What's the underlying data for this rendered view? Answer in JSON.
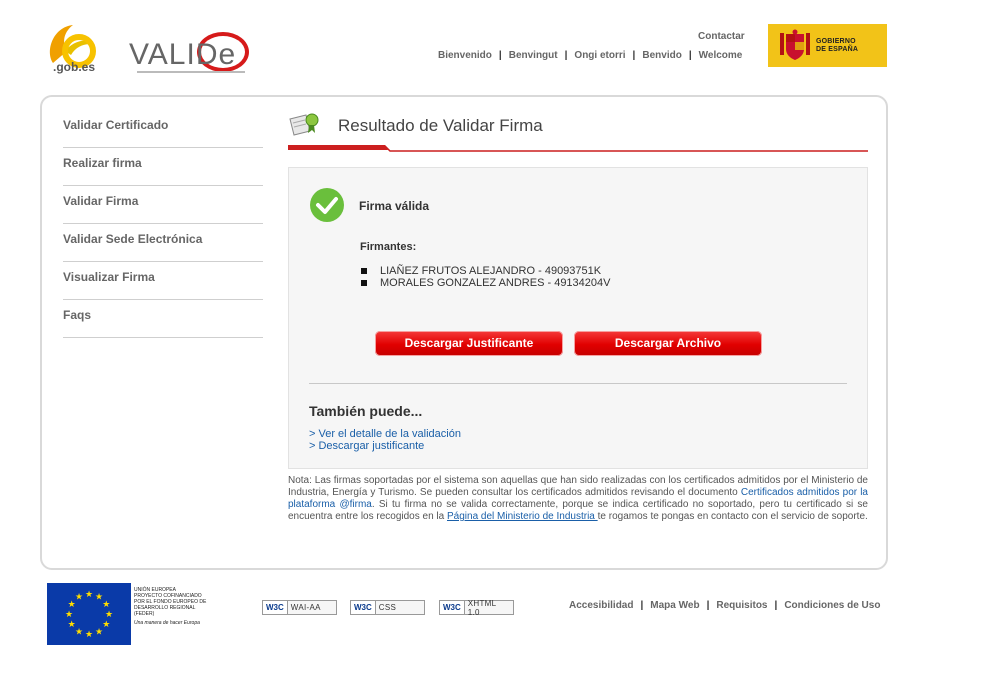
{
  "header": {
    "contact_label": "Contactar",
    "languages": [
      "Bienvenido",
      "Benvingut",
      "Ongi etorri",
      "Benvido",
      "Welcome"
    ],
    "logo_gob_text": ".gob.es",
    "logo_valide_text": "VALIDe",
    "gobierno_text_1": "GOBIERNO",
    "gobierno_text_2": "DE ESPAÑA"
  },
  "sidebar": {
    "items": [
      {
        "label": "Validar Certificado"
      },
      {
        "label": "Realizar firma"
      },
      {
        "label": "Validar Firma"
      },
      {
        "label": "Validar Sede Electrónica"
      },
      {
        "label": "Visualizar Firma"
      },
      {
        "label": "Faqs"
      }
    ]
  },
  "main": {
    "title": "Resultado de Validar Firma",
    "status_label": "Firma válida",
    "signers_title": "Firmantes:",
    "signers": [
      "LIAÑEZ FRUTOS ALEJANDRO - 49093751K",
      "MORALES GONZALEZ ANDRES - 49134204V"
    ],
    "buttons": {
      "download_receipt": "Descargar Justificante",
      "download_file": "Descargar Archivo"
    },
    "also_title": "También puede...",
    "also_links": [
      "> Ver el detalle de la validación",
      "> Descargar justificante"
    ],
    "note": {
      "part1": "Nota: Las firmas soportadas por el sistema son aquellas que han sido realizadas con los certificados admitidos por el Ministerio de Industria, Energía y Turismo. Se pueden consultar los certificados admitidos revisando el documento ",
      "link1": "Certificados admitidos por la plataforma @firma",
      "part2": ". Si tu firma no se valida correctamente, porque se indica certificado no soportado, pero tu certificado si se encuentra entre los recogidos en la ",
      "link2": "Página del Ministerio de Industria ",
      "part3": "te rogamos te pongas en contacto con el servicio de soporte."
    }
  },
  "footer": {
    "eu_text": [
      "UNIÓN EUROPEA",
      "PROYECTO COFINANCIADO",
      "POR EL FONDO EUROPEO DE",
      "DESARROLLO REGIONAL",
      "(FEDER)"
    ],
    "eu_motto": "Una manera de hacer Europa",
    "badges": [
      {
        "w3": "W3C",
        "label": "WAI-AA"
      },
      {
        "w3": "W3C",
        "label": "CSS"
      },
      {
        "w3": "W3C",
        "label": "XHTML 1.0"
      }
    ],
    "links": [
      "Accesibilidad",
      "Mapa Web",
      "Requisitos",
      "Condiciones de Uso"
    ]
  },
  "colors": {
    "accent_red": "#e10000",
    "gobierno_yellow": "#f2c318",
    "link_blue": "#1a5fa8",
    "ok_green": "#6abf3c",
    "eu_blue": "#0a3aa8"
  }
}
